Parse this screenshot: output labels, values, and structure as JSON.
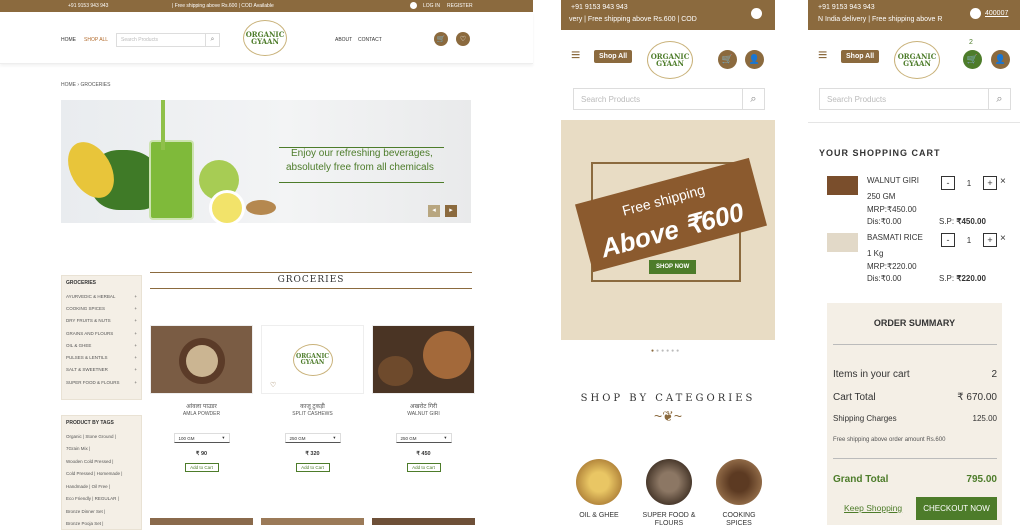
{
  "desktop": {
    "topbar": {
      "phone": "+91 9153 943 943",
      "shipping": "| Free shipping above Rs.600 | COD Available",
      "login": "LOG IN",
      "register": "REGISTER"
    },
    "nav": {
      "home": "HOME",
      "shop_all": "SHOP ALL",
      "search_placeholder": "Search Products",
      "about": "ABOUT",
      "contact": "CONTACT"
    },
    "logo": {
      "line1": "ORGANIC",
      "line2": "GYAAN"
    },
    "breadcrumb": {
      "home": "HOME",
      "sep": "›",
      "current": "GROCERIES"
    },
    "banner": {
      "line1": "Enjoy our refreshing beverages,",
      "line2": "absolutely free from all chemicals"
    },
    "section_title": "GROCERIES",
    "sidebar": {
      "heading": "GROCERIES",
      "items": [
        {
          "label": "AYURVEDIC & HERBAL",
          "plus": "+"
        },
        {
          "label": "COOKING SPICES",
          "plus": "+"
        },
        {
          "label": "DRY FRUITS & NUTS",
          "plus": "+"
        },
        {
          "label": "GRAINS AND FLOURS",
          "plus": "+"
        },
        {
          "label": "OIL & GHEE",
          "plus": "+"
        },
        {
          "label": "PULSES & LENTILS",
          "plus": "+"
        },
        {
          "label": "SALT & SWEETNER",
          "plus": "+"
        },
        {
          "label": "SUPER FOOD & FLOURS",
          "plus": "+"
        }
      ],
      "tags_heading": "PRODUCT BY TAGS",
      "tags": [
        "Organic | Stone Ground |",
        "7Grain Mix |",
        "Wooden Cold Pressed |",
        "Cold Pressed | Homemade |",
        "Handmade | Oil Free |",
        "Eco Friendly | REGULAR |",
        "Bronze Dinner Set |",
        "Bronze Pooja Set |"
      ]
    },
    "products": [
      {
        "hindi": "आंवला पाउडर",
        "name": "AMLA POWDER",
        "size": "100 GM",
        "price": "₹ 90",
        "add": "Add to Cart"
      },
      {
        "hindi": "काजू टुकड़ी",
        "name": "SPLIT CASHEWS",
        "size": "250 GM",
        "price": "₹ 320",
        "add": "Add to Cart"
      },
      {
        "hindi": "अखरोट गिरी",
        "name": "WALNUT GIRI",
        "size": "250 GM",
        "price": "₹ 450",
        "add": "Add to Cart"
      }
    ]
  },
  "mobile1": {
    "topbar": {
      "phone": "+91 9153 943 943",
      "shipping": "very | Free shipping above Rs.600 | COD"
    },
    "shop_all": "Shop All",
    "search_placeholder": "Search Products",
    "promo": {
      "line1": "Free shipping",
      "line2": "Above ₹600",
      "btn": "SHOP NOW"
    },
    "categories_title": "SHOP BY CATEGORIES",
    "categories": [
      {
        "label1": "OIL & GHEE",
        "label2": ""
      },
      {
        "label1": "SUPER FOOD &",
        "label2": "FLOURS"
      },
      {
        "label1": "COOKING",
        "label2": "SPICES"
      }
    ]
  },
  "mobile2": {
    "topbar": {
      "phone": "+91 9153 943 943",
      "shipping": "N India delivery | Free shipping above R",
      "pincode": "400007"
    },
    "shop_all": "Shop All",
    "cart_count": "2",
    "search_placeholder": "Search Products",
    "cart_title": "YOUR SHOPPING CART",
    "items": [
      {
        "name": "WALNUT GIRI",
        "weight": "250 GM",
        "mrp": "MRP:₹450.00",
        "dis": "Dis:₹0.00",
        "sp_label": "S.P:",
        "sp": "₹450.00",
        "qty": "1"
      },
      {
        "name": "BASMATI RICE",
        "weight": "1 Kg",
        "mrp": "MRP:₹220.00",
        "dis": "Dis:₹0.00",
        "sp_label": "S.P:",
        "sp": "₹220.00",
        "qty": "1"
      }
    ],
    "summary": {
      "title": "ORDER SUMMARY",
      "items_label": "Items in your cart",
      "items_value": "2",
      "total_label": "Cart Total",
      "total_value": "₹ 670.00",
      "ship_label": "Shipping Charges",
      "ship_value": "125.00",
      "note": "Free shipping above order amount Rs.600",
      "grand_label": "Grand Total",
      "grand_value": "795.00",
      "keep": "Keep Shopping",
      "checkout": "CHECKOUT NOW"
    }
  },
  "colors": {
    "brown": "#8b6a3e",
    "green": "#4d7c2a",
    "cream": "#f4efe6"
  }
}
